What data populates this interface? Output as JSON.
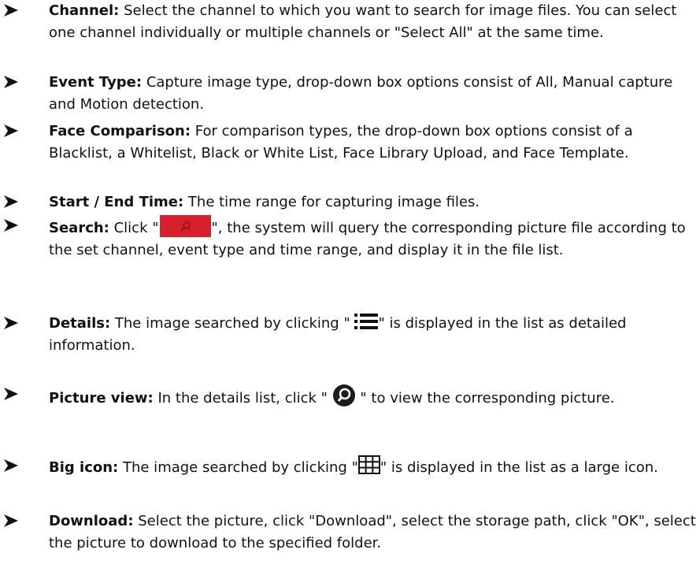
{
  "items": [
    {
      "label": "Channel:",
      "text": " Select the channel to which you want to search for image files. You can select one channel individually or multiple channels or \"Select All\" at the same time."
    },
    {
      "label": "Event Type:",
      "text": " Capture image type, drop-down box options consist of All, Manual capture and Motion detection."
    },
    {
      "label": "Face Comparison:",
      "text": " For comparison types, the drop-down box options consist of a Blacklist, a Whitelist, Black or White List, Face Library Upload, and Face Template."
    },
    {
      "label": "Start / End Time:",
      "text": " The time range for capturing image files."
    },
    {
      "label": "Search:",
      "pre": " Click \"",
      "post": "\", the system will query the corresponding picture file according to the set channel, event type and time range, and display it in the file list."
    },
    {
      "label": "Details:",
      "pre": " The image searched by clicking \" ",
      "post": "\" is displayed in the list as detailed information."
    },
    {
      "label": "Picture view:",
      "pre": " In the details list, click \" ",
      "post": " \" to view the corresponding picture."
    },
    {
      "label": "Big icon:",
      "pre": " The image searched by clicking \"",
      "post": "\" is displayed in the list as a large icon."
    },
    {
      "label": "Download:",
      "text": " Select the picture, click \"Download\", select the storage path, click \"OK\", select the picture to download to the specified folder."
    }
  ],
  "icons": {
    "bullet": "arrowhead-bullet-icon",
    "search": "search-button-icon",
    "details": "list-view-icon",
    "picture_view": "magnifier-icon",
    "big_icon": "grid-view-icon"
  },
  "colors": {
    "search_button": "#d71f2d",
    "text": "#111111"
  }
}
